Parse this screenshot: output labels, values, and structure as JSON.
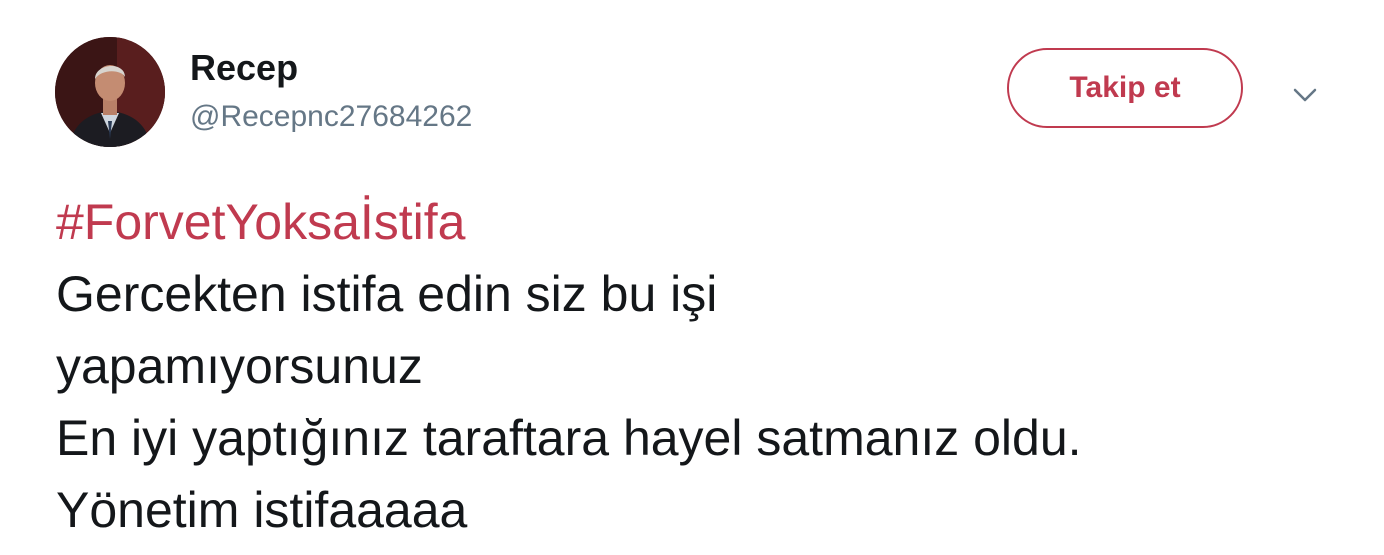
{
  "user": {
    "display_name": "Recep",
    "handle": "@Recepnc27684262"
  },
  "follow_button": {
    "label": "Takip et"
  },
  "more_menu": {
    "icon": "chevron-down-icon"
  },
  "tweet": {
    "hashtag": "#ForvetYoksaİstifa",
    "lines": [
      "Gercekten istifa edin siz bu işi",
      "yapamıyorsunuz",
      "En iyi yaptığınız taraftara hayel satmanız oldu.",
      "Yönetim istifaaaaa"
    ]
  },
  "colors": {
    "accent": "#c03a4f",
    "text_primary": "#14171a",
    "text_secondary": "#657786",
    "background": "#ffffff"
  }
}
